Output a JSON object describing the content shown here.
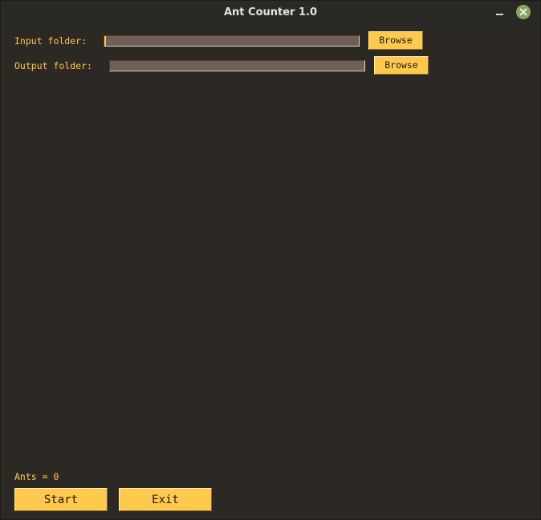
{
  "window": {
    "title": "Ant Counter 1.0"
  },
  "input": {
    "label": "Input folder:",
    "value": "",
    "browse_label": "Browse"
  },
  "output": {
    "label": "Output folder:",
    "value": "",
    "browse_label": "Browse"
  },
  "status": {
    "ants_text": "Ants = 0"
  },
  "actions": {
    "start_label": "Start",
    "exit_label": "Exit"
  },
  "icons": {
    "minimize": "minimize-icon",
    "close": "close-icon"
  },
  "colors": {
    "background": "#2c2925",
    "accent": "#ffc94d",
    "entry_bg": "#6f5f55",
    "close_button": "#87a567"
  }
}
